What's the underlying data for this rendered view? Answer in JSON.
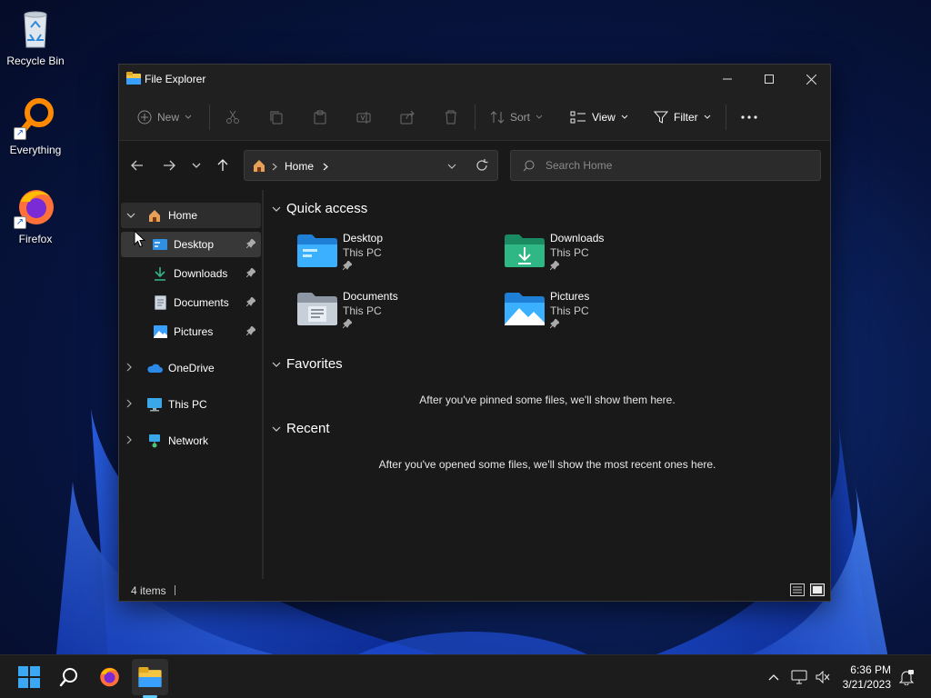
{
  "desktop": {
    "icons": [
      {
        "label": "Recycle Bin"
      },
      {
        "label": "Everything"
      },
      {
        "label": "Firefox"
      }
    ]
  },
  "window": {
    "title": "File Explorer",
    "toolbar": {
      "new_label": "New",
      "sort_label": "Sort",
      "view_label": "View",
      "filter_label": "Filter"
    },
    "address": {
      "location": "Home"
    },
    "search": {
      "placeholder": "Search Home"
    },
    "sidebar": {
      "home": "Home",
      "pinned": [
        {
          "label": "Desktop"
        },
        {
          "label": "Downloads"
        },
        {
          "label": "Documents"
        },
        {
          "label": "Pictures"
        }
      ],
      "onedrive": "OneDrive",
      "thispc": "This PC",
      "network": "Network"
    },
    "content": {
      "quick_access_title": "Quick access",
      "quick_access": [
        {
          "name": "Desktop",
          "location": "This PC"
        },
        {
          "name": "Downloads",
          "location": "This PC"
        },
        {
          "name": "Documents",
          "location": "This PC"
        },
        {
          "name": "Pictures",
          "location": "This PC"
        }
      ],
      "favorites_title": "Favorites",
      "favorites_empty": "After you've pinned some files, we'll show them here.",
      "recent_title": "Recent",
      "recent_empty": "After you've opened some files, we'll show the most recent ones here."
    },
    "status": {
      "items": "4 items"
    }
  },
  "taskbar": {
    "clock_time": "6:36 PM",
    "clock_date": "3/21/2023"
  },
  "colors": {
    "accent": "#60cdff",
    "window_bg": "#191919",
    "folder_blue": "#3aa0ff",
    "folder_green": "#2aa37a"
  }
}
